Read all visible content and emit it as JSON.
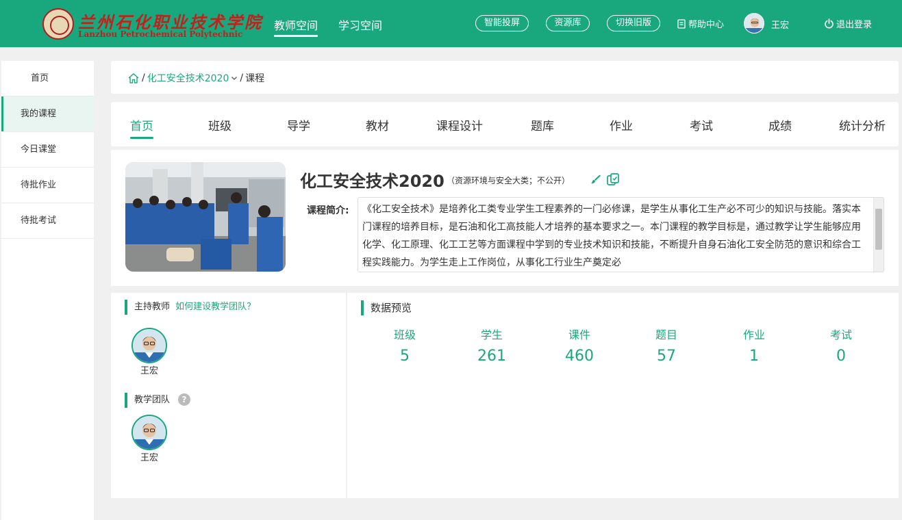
{
  "header": {
    "logo_cn": "兰州石化职业技术学院",
    "logo_en": "Lanzhou Petrochemical Polytechnic",
    "nav": [
      {
        "label": "教师空间",
        "active": true
      },
      {
        "label": "学习空间",
        "active": false
      }
    ],
    "pills": [
      "智能投屏",
      "资源库",
      "切换旧版"
    ],
    "help_label": "帮助中心",
    "user_name": "王宏",
    "logout_label": "退出登录"
  },
  "sidebar": {
    "items": [
      {
        "label": "首页"
      },
      {
        "label": "我的课程",
        "active": true
      },
      {
        "label": "今日课堂"
      },
      {
        "label": "待批作业"
      },
      {
        "label": "待批考试"
      }
    ]
  },
  "breadcrumb": {
    "separator": "/",
    "course": "化工安全技术2020",
    "current": "课程"
  },
  "tabs": [
    "首页",
    "班级",
    "导学",
    "教材",
    "课程设计",
    "题库",
    "作业",
    "考试",
    "成绩",
    "统计分析"
  ],
  "course": {
    "title": "化工安全技术2020",
    "subtitle": "（资源环境与安全大类；不公开）",
    "intro_label": "课程简介:",
    "intro_text": "《化工安全技术》是培养化工类专业学生工程素养的一门必修课，是学生从事化工生产必不可少的知识与技能。落实本门课程的培养目标，是石油和化工高技能人才培养的基本要求之一。本门课程的教学目标是，通过教学让学生能够应用化学、化工原理、化工工艺等方面课程中学到的专业技术知识和技能，不断提升自身石油化工安全防范的意识和综合工程实践能力。为学生走上工作岗位，从事化工行业生产奠定必"
  },
  "teachers": {
    "host_label": "主持教师",
    "help_link": "如何建设教学团队？",
    "host_name": "王宏",
    "team_label": "教学团队",
    "team_help": "?",
    "team_member_name": "王宏"
  },
  "data_preview": {
    "title": "数据预览",
    "stats": [
      {
        "label": "班级",
        "value": "5"
      },
      {
        "label": "学生",
        "value": "261"
      },
      {
        "label": "课件",
        "value": "460"
      },
      {
        "label": "题目",
        "value": "57"
      },
      {
        "label": "作业",
        "value": "1"
      },
      {
        "label": "考试",
        "value": "0"
      }
    ]
  },
  "colors": {
    "brand": "#19a87e",
    "logo_red": "#c0221b"
  }
}
